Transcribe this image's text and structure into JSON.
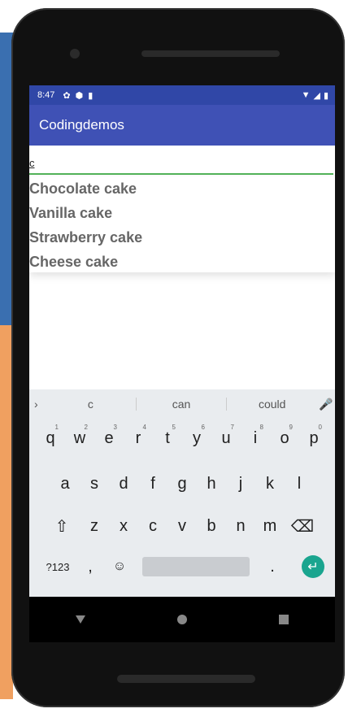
{
  "status_bar": {
    "time": "8:47"
  },
  "app_bar": {
    "title": "Codingdemos"
  },
  "search_input": {
    "value": "c"
  },
  "suggestions": [
    {
      "label": "Chocolate cake"
    },
    {
      "label": "Vanilla cake"
    },
    {
      "label": "Strawberry cake"
    },
    {
      "label": "Cheese cake"
    }
  ],
  "keyboard": {
    "suggestion_bar": [
      "c",
      "can",
      "could"
    ],
    "row1": [
      {
        "key": "q",
        "num": "1"
      },
      {
        "key": "w",
        "num": "2"
      },
      {
        "key": "e",
        "num": "3"
      },
      {
        "key": "r",
        "num": "4"
      },
      {
        "key": "t",
        "num": "5"
      },
      {
        "key": "y",
        "num": "6"
      },
      {
        "key": "u",
        "num": "7"
      },
      {
        "key": "i",
        "num": "8"
      },
      {
        "key": "o",
        "num": "9"
      },
      {
        "key": "p",
        "num": "0"
      }
    ],
    "row2": [
      "a",
      "s",
      "d",
      "f",
      "g",
      "h",
      "j",
      "k",
      "l"
    ],
    "row3": [
      "z",
      "x",
      "c",
      "v",
      "b",
      "n",
      "m"
    ],
    "row4": {
      "symbols": "?123",
      "comma": ",",
      "period": "."
    }
  },
  "colors": {
    "status_bar": "#3047a7",
    "app_bar": "#3f51b5",
    "input_underline": "#53b45a",
    "enter_key": "#1aa58f"
  },
  "icons": [
    "settings-icon",
    "shield-icon",
    "sd-card-icon",
    "wifi-icon",
    "signal-icon",
    "battery-icon",
    "chevron-right-icon",
    "mic-icon",
    "shift-icon",
    "backspace-icon",
    "emoji-icon",
    "enter-icon",
    "back-icon",
    "home-icon",
    "recents-icon"
  ]
}
